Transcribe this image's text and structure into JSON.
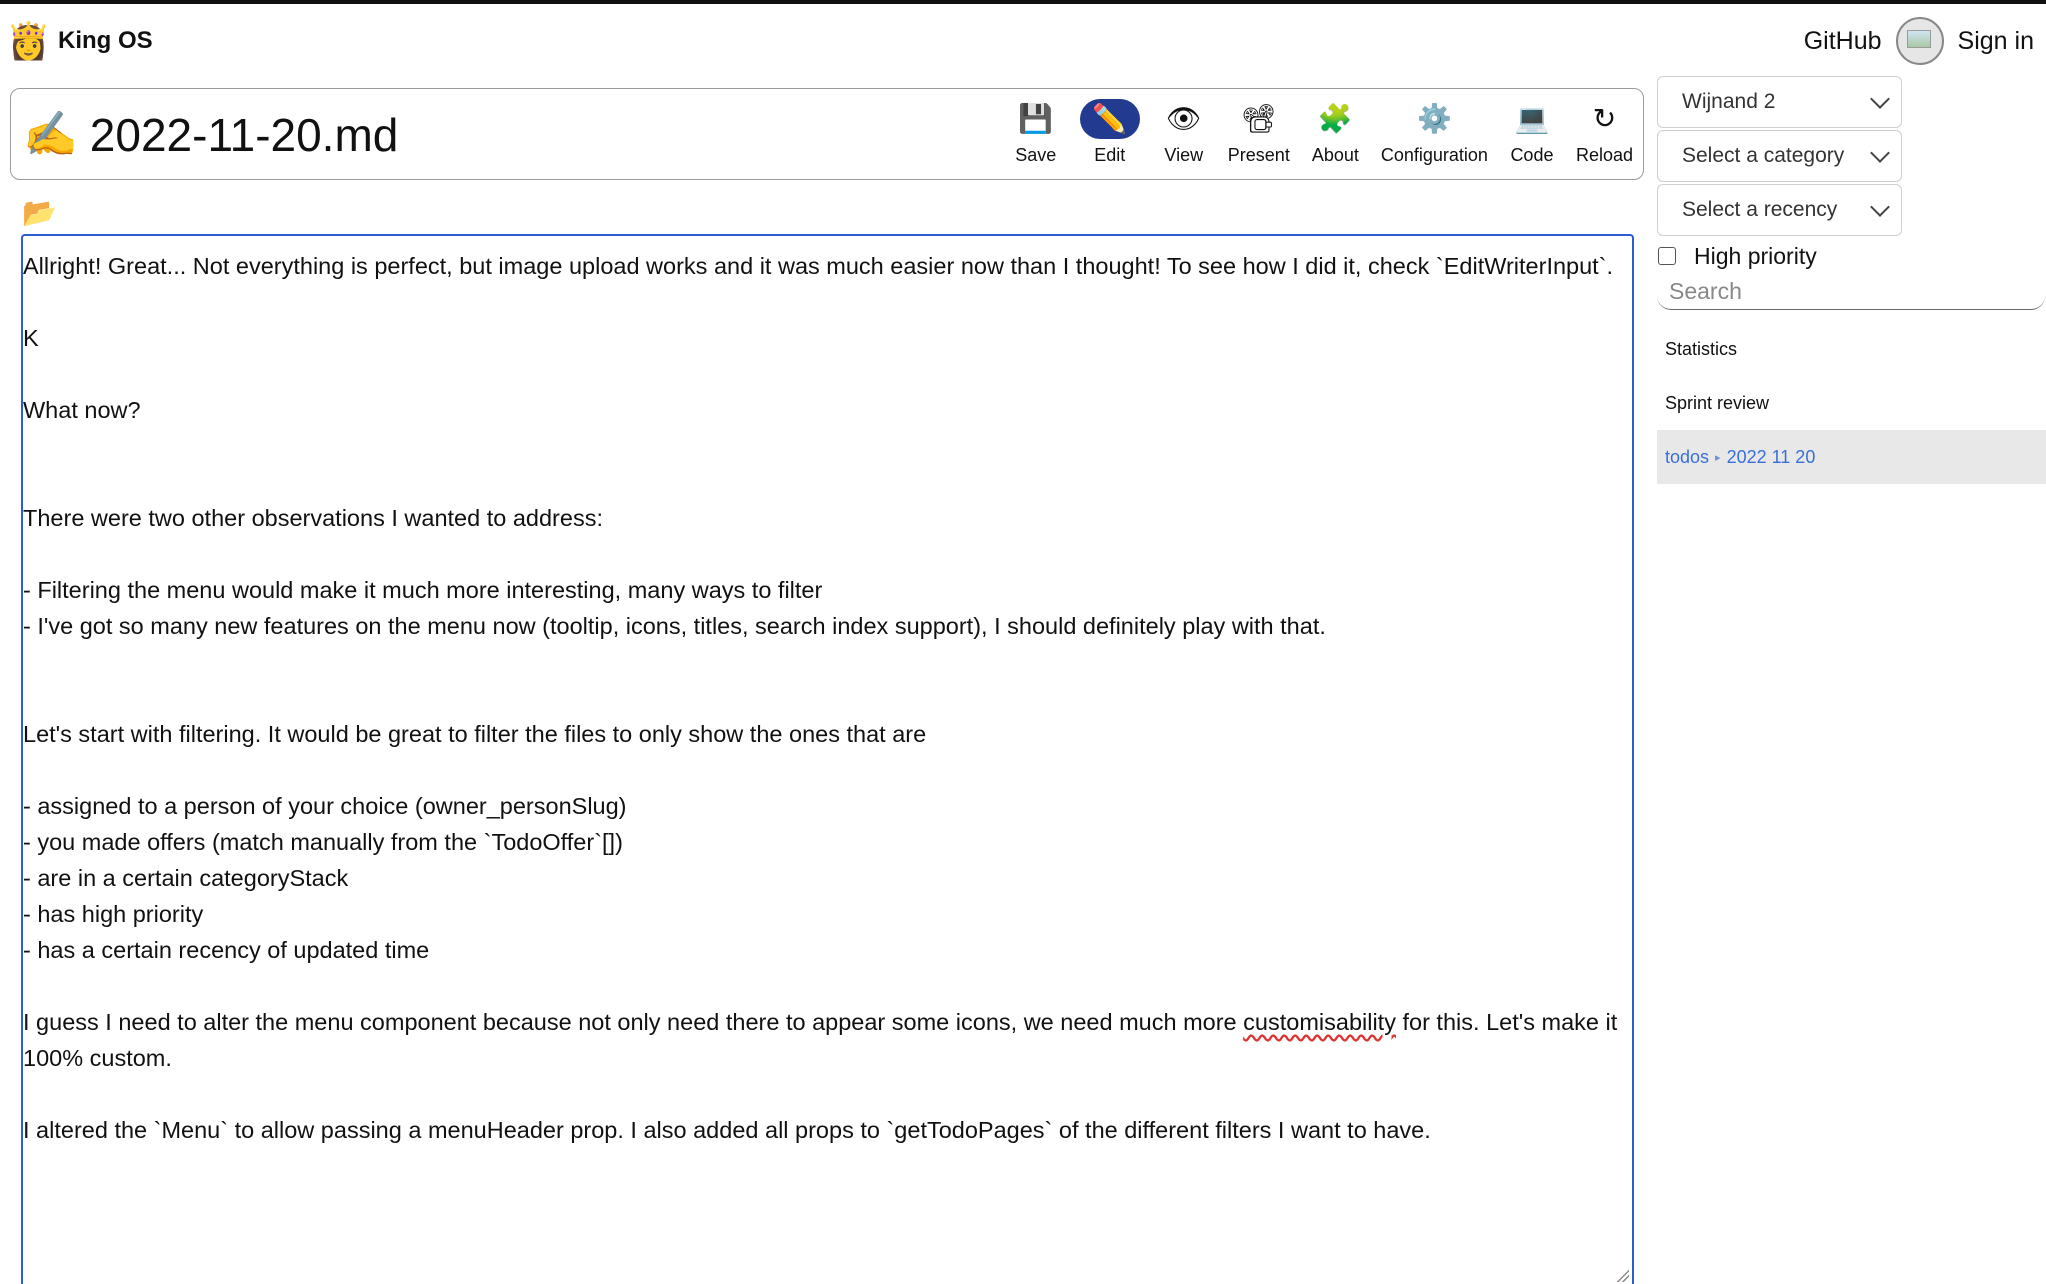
{
  "app": {
    "brand_icon": "👸",
    "brand_name": "King OS",
    "github_label": "GitHub",
    "sign_in_label": "Sign in"
  },
  "document": {
    "title_icon": "✍️",
    "title": "2022-11-20.md",
    "folder_icon": "📂"
  },
  "toolbar": {
    "items": [
      {
        "label": "Save",
        "icon": "💾",
        "icon_name": "floppy-disk-icon"
      },
      {
        "label": "Edit",
        "icon": "✏️",
        "icon_name": "pencil-icon",
        "active": true
      },
      {
        "label": "View",
        "icon": "👁",
        "icon_name": "eye-icon"
      },
      {
        "label": "Present",
        "icon": "📽",
        "icon_name": "projector-icon"
      },
      {
        "label": "About",
        "icon": "🧩",
        "icon_name": "puzzle-icon"
      },
      {
        "label": "Configuration",
        "icon": "⚙️",
        "icon_name": "gear-icon"
      },
      {
        "label": "Code",
        "icon": "💻",
        "icon_name": "laptop-icon"
      },
      {
        "label": "Reload",
        "icon": "↻",
        "icon_name": "reload-icon"
      }
    ]
  },
  "editor": {
    "lines": [
      "Allright! Great... Not everything is perfect, but image upload works and it was much easier now than I thought! To see how I did it, check `EditWriterInput`.",
      "",
      "K",
      "",
      "What now?",
      "",
      "",
      "There were two other observations I wanted to address:",
      "",
      "- Filtering the menu would make it much more interesting, many ways to filter",
      "- I've got so many new features on the menu now (tooltip, icons, titles, search index support), I should definitely play with that.",
      "",
      "",
      "Let's start with filtering. It would be great to filter the files to only show the ones that are",
      "",
      "- assigned to a person of your choice (owner_personSlug)",
      "- you made offers (match manually from the `TodoOffer`[])",
      "- are in a certain categoryStack",
      "- has high priority",
      "- has a certain recency of updated time",
      "",
      "I guess I need to alter the menu component because not only need there to appear some icons, we need much more customisability for this. Let's make it 100% custom.",
      "",
      "I altered the `Menu` to allow passing a menuHeader prop. I also added all props to `getTodoPages` of the different filters I want to have."
    ]
  },
  "sidebar": {
    "person_select": "Wijnand 2",
    "category_select": "Select a category",
    "recency_select": "Select a recency",
    "priority_label": "High priority",
    "search_placeholder": "Search",
    "menu": [
      {
        "label": "Statistics"
      },
      {
        "label": "Sprint review"
      },
      {
        "label_parent": "todos",
        "label_child": "2022 11 20",
        "active": true
      }
    ]
  },
  "colors": {
    "accent": "#2b5fd1",
    "active_button": "#233a91",
    "active_link": "#3a6fd8",
    "active_bg": "#e8e8e8"
  }
}
